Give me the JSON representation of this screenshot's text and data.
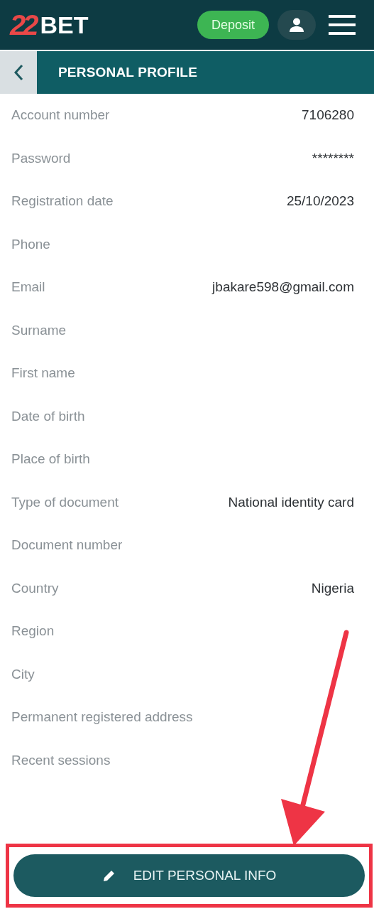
{
  "header": {
    "logo": {
      "digits": "22",
      "word": "BET"
    },
    "deposit_button": "Deposit"
  },
  "subheader": {
    "title": "PERSONAL PROFILE"
  },
  "profile_rows": [
    {
      "label": "Account number",
      "value": "7106280"
    },
    {
      "label": "Password",
      "value": "********"
    },
    {
      "label": "Registration date",
      "value": "25/10/2023"
    },
    {
      "label": "Phone"
    },
    {
      "label": "Email",
      "value": "jbakare598@gmail.com"
    },
    {
      "label": "Surname"
    },
    {
      "label": "First name"
    },
    {
      "label": "Date of birth"
    },
    {
      "label": "Place of birth"
    },
    {
      "label": "Type of document",
      "value": "National identity card"
    },
    {
      "label": "Document number"
    },
    {
      "label": "Country",
      "value": "Nigeria"
    },
    {
      "label": "Region"
    },
    {
      "label": "City"
    },
    {
      "label": "Permanent registered address"
    },
    {
      "label": "Recent sessions"
    }
  ],
  "edit_button": {
    "label": "EDIT PERSONAL INFO",
    "highlighted": true
  }
}
